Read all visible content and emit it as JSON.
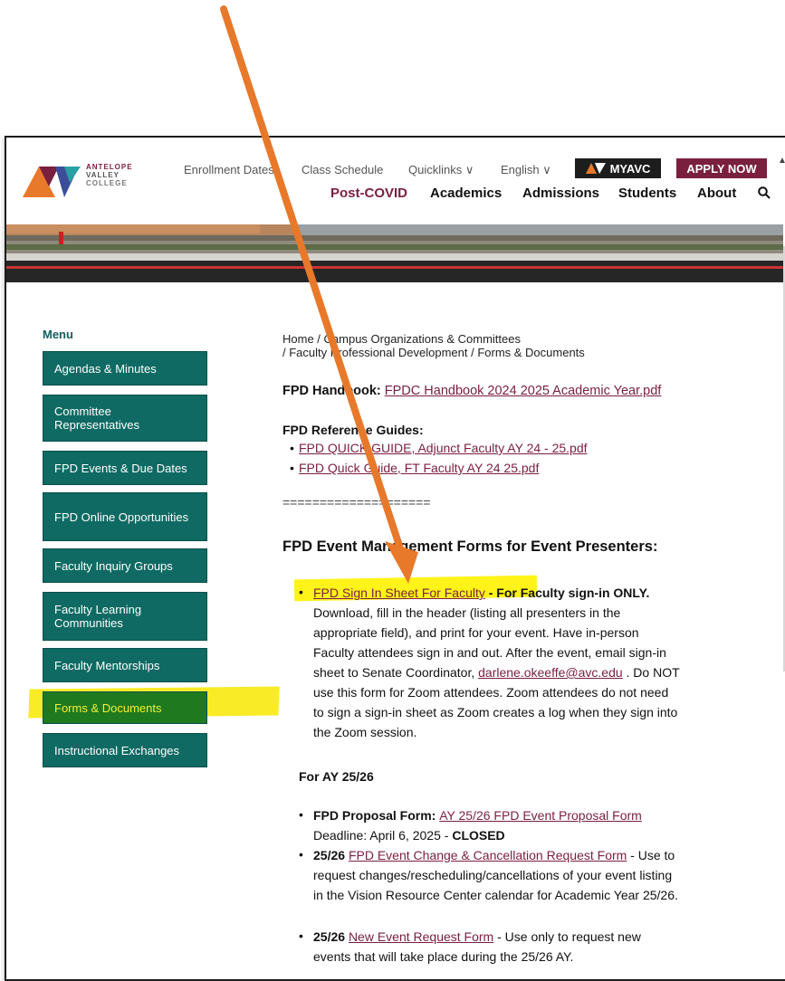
{
  "header": {
    "logo": {
      "line1": "ANTELOPE",
      "line2": "VALLEY",
      "line3": "COLLEGE"
    },
    "top_links": [
      "Enrollment Dates",
      "Class Schedule",
      "Quicklinks ∨",
      "English ∨"
    ],
    "myavc_label": "MYAVC",
    "apply_label": "APPLY NOW",
    "main_nav": [
      "Post-COVID",
      "Academics",
      "Admissions",
      "Students",
      "About"
    ]
  },
  "sidebar": {
    "title": "Menu",
    "items": [
      "Agendas & Minutes",
      "Committee Representatives",
      "FPD Events & Due Dates",
      "FPD Online Opportunities",
      "Faculty Inquiry Groups",
      "Faculty Learning Communities",
      "Faculty Mentorships",
      "Forms & Documents",
      "Instructional Exchanges"
    ]
  },
  "breadcrumb": {
    "line1": "Home / Campus Organizations & Committees",
    "line2": "/ Faculty Professional Development / Forms & Documents"
  },
  "content": {
    "handbook_label": "FPD Handbook:",
    "handbook_link": "FPDC Handbook 2024 2025 Academic Year.pdf",
    "ref_label": "FPD Reference Guides:",
    "ref_links": [
      "FPD QUICK GUIDE, Adjunct Faculty AY 24 - 25.pdf",
      "FPD Quick Guide, FT Faculty AY 24 25.pdf"
    ],
    "divider": "====================",
    "forms_heading": "FPD Event Management Forms for Event Presenters:",
    "signin_link": "FPD Sign In Sheet For Faculty",
    "signin_bold": " - For Faculty sign-in ONLY.",
    "signin_lines": [
      "Download, fill in the header (listing all presenters in the",
      "appropriate field), and print for your event. Have in-person",
      "Faculty attendees sign in and out. After the event, email sign-in"
    ],
    "signin_line4_pre": "sheet to Senate Coordinator, ",
    "signin_email": "darlene.okeeffe@avc.edu",
    "signin_line4_post": " . Do NOT",
    "signin_lines_after": [
      "use this form for Zoom attendees. Zoom attendees do not need",
      "to sign a sign-in sheet as Zoom creates a log when they sign into",
      "the Zoom session."
    ],
    "ay_heading": "For AY 25/26",
    "proposal_bold": "FPD Proposal Form: ",
    "proposal_link": "AY 25/26 FPD Event Proposal Form",
    "proposal_deadline": "Deadline: April 6, 2025 - ",
    "proposal_closed": "CLOSED",
    "change_bold": "25/26 ",
    "change_link": "FPD Event Change & Cancellation Request Form",
    "change_rest": " - Use to",
    "change_lines": [
      "request changes/rescheduling/cancellations of your event listing",
      "in the Vision Resource Center calendar for Academic Year 25/26."
    ],
    "new_bold": "25/26 ",
    "new_link": "New Event Request Form",
    "new_rest": " - Use only to request new",
    "new_line2": "events that will take place during the 25/26 AY."
  },
  "colors": {
    "teal": "#0e6a63",
    "maroon": "#7a1f3d",
    "highlight": "#fff200",
    "arrow": "#e8782a"
  }
}
